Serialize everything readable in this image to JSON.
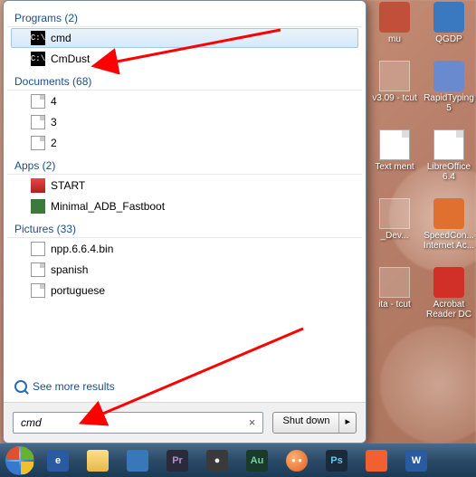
{
  "groups": {
    "programs": {
      "header": "Programs (2)",
      "items": [
        {
          "label": "cmd",
          "icon": "cmd",
          "selected": true
        },
        {
          "label": "CmDust",
          "icon": "cmd"
        }
      ]
    },
    "documents": {
      "header": "Documents (68)",
      "items": [
        {
          "label": "4",
          "icon": "doc"
        },
        {
          "label": "3",
          "icon": "doc"
        },
        {
          "label": "2",
          "icon": "doc"
        }
      ]
    },
    "apps": {
      "header": "Apps (2)",
      "items": [
        {
          "label": "START",
          "icon": "start"
        },
        {
          "label": "Minimal_ADB_Fastboot",
          "icon": "adb"
        }
      ]
    },
    "pictures": {
      "header": "Pictures (33)",
      "items": [
        {
          "label": "npp.6.6.4.bin",
          "icon": "bin"
        },
        {
          "label": "spanish",
          "icon": "doc"
        },
        {
          "label": "portuguese",
          "icon": "doc"
        }
      ]
    }
  },
  "see_more": "See more results",
  "search": {
    "value": "cmd",
    "clear": "×"
  },
  "shutdown": {
    "label": "Shut down",
    "arrow": "▸"
  },
  "desktop_icons": [
    {
      "label": "mu",
      "color": "#c0503a"
    },
    {
      "label": "QGDP",
      "color": "#3a78c0"
    },
    {
      "label": "v3.09 - tcut",
      "color": "#3a78c0",
      "blank": true
    },
    {
      "label": "RapidTyping 5",
      "color": "#6a8ad0"
    },
    {
      "label": "Text ment",
      "color": "#ffffff",
      "paper": true
    },
    {
      "label": "LibreOffice 6.4",
      "color": "#ffffff",
      "paper": true
    },
    {
      "label": "_Dev...",
      "color": "#ffffff",
      "blank": true
    },
    {
      "label": "SpeedCon... Internet Ac...",
      "color": "#e07030"
    },
    {
      "label": "ita - tcut",
      "color": "#805a40",
      "blank": true
    },
    {
      "label": "Acrobat Reader DC",
      "color": "#d03028"
    }
  ],
  "taskbar": [
    {
      "name": "ie",
      "bg": "#2a5aa0",
      "glyph": "e"
    },
    {
      "name": "explorer",
      "bg": "#e8c56a",
      "glyph": ""
    },
    {
      "name": "app1",
      "bg": "#3878b8",
      "glyph": ""
    },
    {
      "name": "premiere",
      "bg": "#2a2a3a",
      "glyph": "Pr",
      "fg": "#b090d0"
    },
    {
      "name": "app2",
      "bg": "#3a3a3a",
      "glyph": "●",
      "fg": "#f0f0f0"
    },
    {
      "name": "audition",
      "bg": "#1a3a2a",
      "glyph": "Au",
      "fg": "#70d0a0"
    },
    {
      "name": "gom",
      "bg": "#f08030",
      "glyph": ""
    },
    {
      "name": "photoshop",
      "bg": "#1a2a3a",
      "glyph": "Ps",
      "fg": "#70c0f0"
    },
    {
      "name": "xiaomi",
      "bg": "#f06030",
      "glyph": ""
    },
    {
      "name": "word",
      "bg": "#2a5aa0",
      "glyph": "W"
    }
  ]
}
